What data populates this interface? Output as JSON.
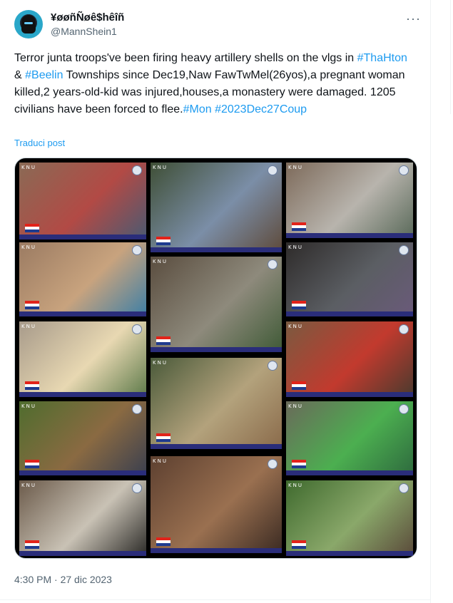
{
  "tweet": {
    "display_name": "¥øøñÑøê$hêîñ",
    "handle": "@MannShein1",
    "more_icon": "more-horizontal-icon",
    "text_parts": [
      {
        "text": "Terror junta troops've been firing heavy artillery shells on the vlgs in ",
        "hashtag": false
      },
      {
        "text": "#ThaHton",
        "hashtag": true
      },
      {
        "text": " & ",
        "hashtag": false
      },
      {
        "text": "#Beelin",
        "hashtag": true
      },
      {
        "text": " Townships since Dec19,Naw FawTwMel(26yos),a pregnant woman killed,2 years-old-kid was injured,houses,a monastery were damaged. 1205 civilians have been forced to flee.",
        "hashtag": false
      },
      {
        "text": "#Mon",
        "hashtag": true
      },
      {
        "text": " ",
        "hashtag": false
      },
      {
        "text": "#2023Dec27Coup",
        "hashtag": true
      }
    ],
    "translate_label": "Traduci post",
    "timestamp": "4:30 PM · 27 dic 2023"
  },
  "media": {
    "tile_logo": "KNU",
    "tiles": [
      {
        "col": 0,
        "row": 0,
        "colors": [
          "#8a6a55",
          "#b24a45",
          "#4a5a72"
        ]
      },
      {
        "col": 0,
        "row": 1,
        "colors": [
          "#9b7b62",
          "#c8a37e",
          "#3d7fa6"
        ]
      },
      {
        "col": 0,
        "row": 2,
        "colors": [
          "#a79a8a",
          "#e8d8b2",
          "#5d7a4a"
        ]
      },
      {
        "col": 0,
        "row": 3,
        "colors": [
          "#4f6d2e",
          "#8a6a42",
          "#3a3f4f"
        ]
      },
      {
        "col": 0,
        "row": 4,
        "colors": [
          "#6b5a4a",
          "#c9c2b5",
          "#2b2a27"
        ]
      },
      {
        "col": 1,
        "row": 0,
        "colors": [
          "#3f4f36",
          "#7b8ea7",
          "#5e4a3a"
        ]
      },
      {
        "col": 1,
        "row": 1,
        "colors": [
          "#5a4d3f",
          "#8e8a7c",
          "#3f5a36"
        ]
      },
      {
        "col": 1,
        "row": 2,
        "colors": [
          "#4a5a3a",
          "#b3a27c",
          "#8a6a4a"
        ]
      },
      {
        "col": 1,
        "row": 3,
        "colors": [
          "#5d4030",
          "#9a7050",
          "#3a2a22"
        ]
      },
      {
        "col": 2,
        "row": 0,
        "colors": [
          "#7d6a5a",
          "#b8b4ad",
          "#5a6a5a"
        ]
      },
      {
        "col": 2,
        "row": 1,
        "colors": [
          "#2e2b2a",
          "#5b5e63",
          "#6a5a7a"
        ]
      },
      {
        "col": 2,
        "row": 2,
        "colors": [
          "#7a5a40",
          "#c23a2e",
          "#4a3a2e"
        ]
      },
      {
        "col": 2,
        "row": 3,
        "colors": [
          "#6a6a5a",
          "#4caf50",
          "#2e6a3e"
        ]
      },
      {
        "col": 2,
        "row": 4,
        "colors": [
          "#3f6a2e",
          "#8aa86a",
          "#5a4a3a"
        ]
      }
    ]
  },
  "colors": {
    "accent": "#1d9bf0",
    "text": "#0f1419",
    "secondary": "#536471"
  }
}
